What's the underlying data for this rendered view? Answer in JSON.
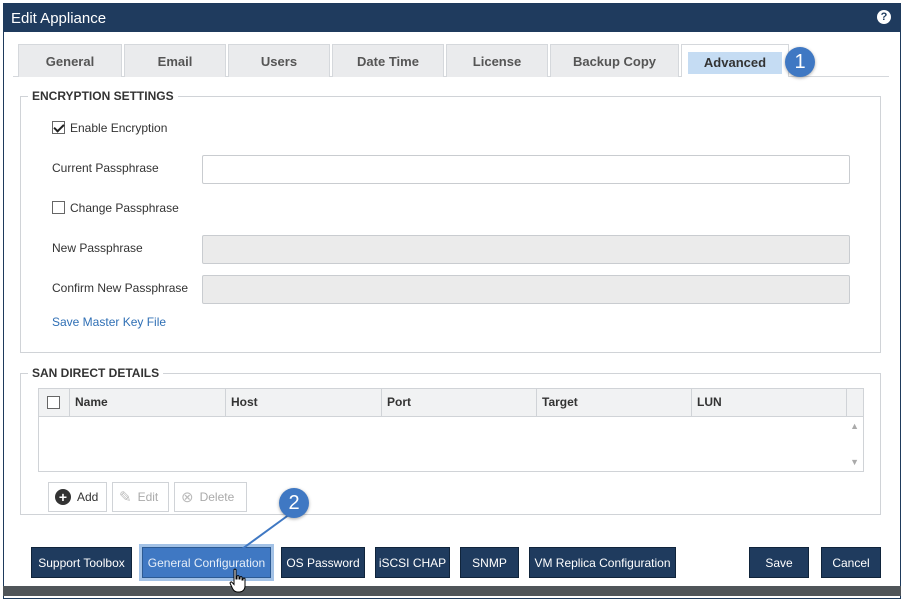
{
  "window": {
    "title": "Edit Appliance",
    "help_icon": "help-icon"
  },
  "tabs": [
    {
      "label": "General"
    },
    {
      "label": "Email"
    },
    {
      "label": "Users"
    },
    {
      "label": "Date Time"
    },
    {
      "label": "License"
    },
    {
      "label": "Backup Copy"
    },
    {
      "label": "Advanced"
    }
  ],
  "active_tab": "Advanced",
  "callouts": {
    "one": "1",
    "two": "2"
  },
  "encryption": {
    "legend": "ENCRYPTION SETTINGS",
    "enable_label": "Enable Encryption",
    "enable_checked": true,
    "current_passphrase_label": "Current Passphrase",
    "current_passphrase_value": "",
    "change_passphrase_label": "Change Passphrase",
    "change_passphrase_checked": false,
    "new_passphrase_label": "New Passphrase",
    "confirm_passphrase_label": "Confirm New Passphrase",
    "save_key_link": "Save Master Key File"
  },
  "san": {
    "legend": "SAN DIRECT DETAILS",
    "columns": [
      "Name",
      "Host",
      "Port",
      "Target",
      "LUN"
    ],
    "rows": [],
    "buttons": {
      "add": "Add",
      "edit": "Edit",
      "delete": "Delete"
    }
  },
  "footer": {
    "support_toolbox": "Support Toolbox",
    "general_configuration": "General Configuration",
    "os_password": "OS Password",
    "iscsi_chap": "iSCSI CHAP",
    "snmp": "SNMP",
    "vm_replica": "VM Replica Configuration",
    "save": "Save",
    "cancel": "Cancel"
  },
  "colors": {
    "primary": "#1f3b5e",
    "accent": "#3f78c3",
    "link": "#2f6fb5"
  }
}
